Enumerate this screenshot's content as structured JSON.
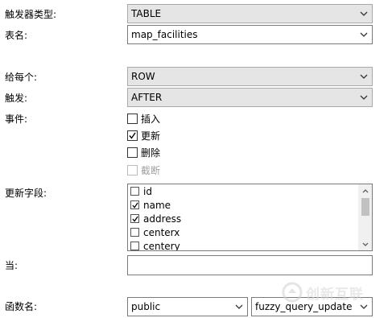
{
  "labels": {
    "trigger_type": "触发器类型:",
    "table_name": "表名:",
    "for_each": "给每个:",
    "fires": "触发:",
    "events": "事件:",
    "update_fields": "更新字段:",
    "when": "当:",
    "function_name": "函数名:"
  },
  "fields": {
    "trigger_type": "TABLE",
    "table_name": "map_facilities",
    "for_each": "ROW",
    "fires": "AFTER",
    "when": "",
    "function_schema": "public",
    "function_name": "fuzzy_query_update"
  },
  "events": [
    {
      "label": "插入",
      "checked": false,
      "disabled": false
    },
    {
      "label": "更新",
      "checked": true,
      "disabled": false
    },
    {
      "label": "删除",
      "checked": false,
      "disabled": false
    },
    {
      "label": "截断",
      "checked": false,
      "disabled": true
    }
  ],
  "update_columns": [
    {
      "label": "id",
      "checked": false
    },
    {
      "label": "name",
      "checked": true
    },
    {
      "label": "address",
      "checked": true
    },
    {
      "label": "centerx",
      "checked": false
    },
    {
      "label": "centery",
      "checked": false
    }
  ],
  "watermark": {
    "text": "创新互联"
  },
  "icons": {
    "dropdown": "chevron-down-icon",
    "check": "check-icon",
    "scroll_up": "scroll-up-arrow-icon",
    "scroll_down": "scroll-down-arrow-icon"
  }
}
